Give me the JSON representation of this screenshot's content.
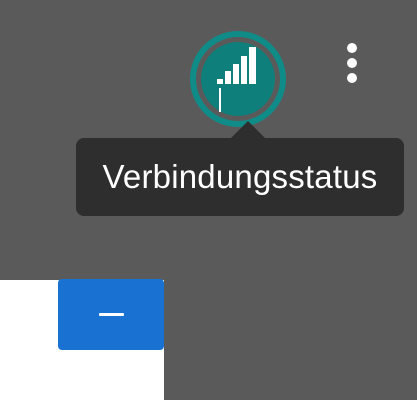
{
  "toolbar": {
    "status_icon": "signal-strength-icon",
    "status_tooltip": "Verbindungsstatus",
    "more_icon": "more-vertical-icon"
  },
  "panel": {
    "collapse_icon": "minus-icon"
  },
  "colors": {
    "background": "#5a5a5a",
    "status_ring": "#108c88",
    "status_fill": "#0f7f7b",
    "tooltip_bg": "#2e2e2e",
    "accent_button": "#1971d2"
  }
}
